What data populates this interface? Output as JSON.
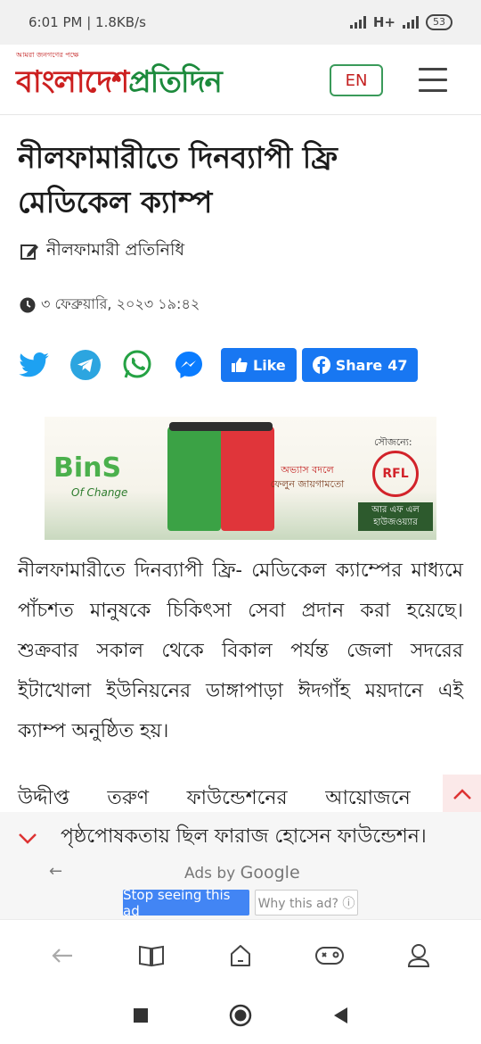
{
  "status_bar": {
    "time_speed": "6:01 PM | 1.8KB/s",
    "network": "H+",
    "battery": "53"
  },
  "header": {
    "tagline": "আমরা জনগণের পক্ষে",
    "logo_red": "বাংলাদেশ",
    "logo_green": "প্রতিদিন",
    "lang_button": "EN"
  },
  "article": {
    "title": "নীলফামারীতে দিনব্যাপী ফ্রি মেডিকেল ক্যাম্প",
    "author": "নীলফামারী প্রতিনিধি",
    "date": "৩ ফেব্রুয়ারি, ২০২৩ ১৯:৪২",
    "paragraph1": "নীলফামারীতে দিনব্যাপী ফ্রি- মেডিকেল ক্যাম্পের মাধ্যমে পাঁচশত মানুষকে চিকিৎসা সেবা প্রদান করা হয়েছে। শুক্রবার সকাল থেকে বিকাল পর্যন্ত জেলা সদরের ইটাখোলা ইউনিয়নের ডাঙ্গাপাড়া ঈদগাঁহ ময়দানে এই ক্যাম্প অনুষ্ঠিত হয়।",
    "paragraph2": "উদ্দীপ্ত তরুণ ফাউন্ডেশনের আয়োজনে এ"
  },
  "share": {
    "like_label": "Like",
    "share_label": "Share",
    "share_count": "47"
  },
  "banner": {
    "bins_text": "BinS",
    "of_change": "Of Change",
    "slogan_1": "অভ্যাস বদলে",
    "slogan_2": "ফেলুন জায়গামতো",
    "courtesy": "সৌজন্যে:",
    "rfl": "RFL",
    "brand_line1": "আর এফ এল",
    "brand_line2": "হাউজওয়্যার"
  },
  "ad_bar": {
    "overlay_text": "পৃষ্ঠপোষকতায় ছিল ফারাজ হোসেন ফাউন্ডেশন।",
    "ads_by": "Ads by",
    "google": "Google",
    "stop_seeing": "Stop seeing this ad",
    "why_ad": "Why this ad? ⓘ"
  },
  "icons": {
    "colors": {
      "twitter": "#1da1f2",
      "telegram": "#2ca5e0",
      "whatsapp": "#25a244",
      "messenger": "#0a7cff",
      "facebook": "#1877f2"
    }
  }
}
